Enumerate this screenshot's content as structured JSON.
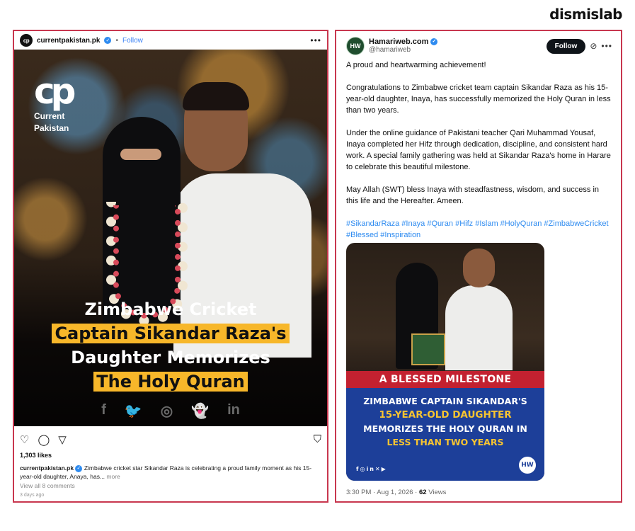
{
  "brand": "dismislab",
  "instagram": {
    "avatar_text": "cp",
    "username": "currentpakistan.pk",
    "verified": "✓",
    "dot": "•",
    "follow": "Follow",
    "more": "•••",
    "image": {
      "logo_mark": "cp",
      "logo_line1": "Current",
      "logo_line2": "Pakistan",
      "headline": {
        "line1": "Zimbabwe Cricket",
        "line2": "Captain Sikandar Raza's",
        "line3": "Daughter Memorizes",
        "line4": "The Holy Quran"
      },
      "social": [
        "f",
        "🐦",
        "◎",
        "👻",
        "in"
      ]
    },
    "actions": {
      "like": "♡",
      "comment": "◯",
      "share": "▽",
      "save": "⛉"
    },
    "likes": "1,303 likes",
    "caption_user": "currentpakistan.pk",
    "caption_text": "Zimbabwe cricket star Sikandar Raza is celebrating a proud family moment as his 15-year-old daughter, Anaya, has...",
    "caption_more": "more",
    "comments": "View all 8 comments",
    "time_ago": "3 days ago"
  },
  "twitter": {
    "avatar_text": "HW",
    "name": "Hamariweb.com",
    "verified": "✓",
    "handle": "@hamariweb",
    "follow": "Follow",
    "grok": "⊘",
    "more": "•••",
    "paragraphs": [
      "A proud and heartwarming achievement!",
      "Congratulations to Zimbabwe cricket team captain Sikandar Raza as his 15-year-old daughter, Inaya, has successfully memorized the Holy Quran in less than two years.",
      "Under the online guidance of Pakistani teacher Qari Muhammad Yousaf, Inaya completed her Hifz through dedication, discipline, and consistent hard work. A special family gathering was held at Sikandar Raza's home in Harare to celebrate this beautiful milestone.",
      "May Allah (SWT) bless Inaya with steadfastness, wisdom, and success in this life and the Hereafter. Ameen."
    ],
    "hashtags": "#SikandarRaza #Inaya #Quran #Hifz #Islam #HolyQuran #ZimbabweCricket #Blessed #Inspiration",
    "card": {
      "banner": "A BLESSED MILESTONE",
      "line1": "ZIMBABWE CAPTAIN SIKANDAR'S",
      "line2": "15-YEAR-OLD DAUGHTER",
      "line3": "MEMORIZES THE HOLY QURAN IN",
      "line4": "LESS THAN TWO YEARS",
      "social_icons": "f◎in✕▶",
      "logo": "HW"
    },
    "timestamp": "3:30 PM · Aug 1, 2026 · ",
    "views_count": "62",
    "views_label": " Views"
  }
}
